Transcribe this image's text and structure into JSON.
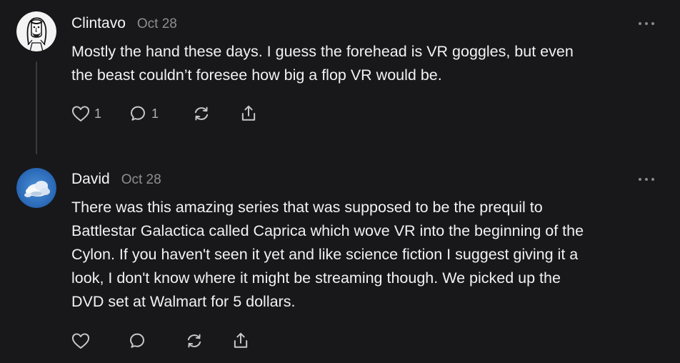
{
  "comments": [
    {
      "author": "Clintavo",
      "date": "Oct 28",
      "avatar_icon": "sketch-portrait",
      "text": "Mostly the hand these days. I guess the forehead is VR goggles, but even\nthe beast couldn’t foresee how big a flop VR would be.",
      "likes": "1",
      "replies": "1"
    },
    {
      "author": "David",
      "date": "Oct 28",
      "avatar_icon": "sky-clouds",
      "text": "There was this amazing series that was supposed to be the prequil to\nBattlestar Galactica called Caprica which wove VR into the beginning of the\nCylon. If you haven't seen it yet and like science fiction I suggest giving it a\nlook, I don't know where it might be streaming though. We picked up the\nDVD set at Walmart for 5 dollars.",
      "likes": "",
      "replies": ""
    }
  ],
  "icons": {
    "like": "heart-icon",
    "reply": "comment-icon",
    "restack": "restack-icon",
    "share": "share-icon",
    "more": "more-icon"
  },
  "colors": {
    "background": "#18181a",
    "text": "#f2f2f2",
    "muted": "#8e8e93",
    "thread_line": "#3a3a3c"
  }
}
